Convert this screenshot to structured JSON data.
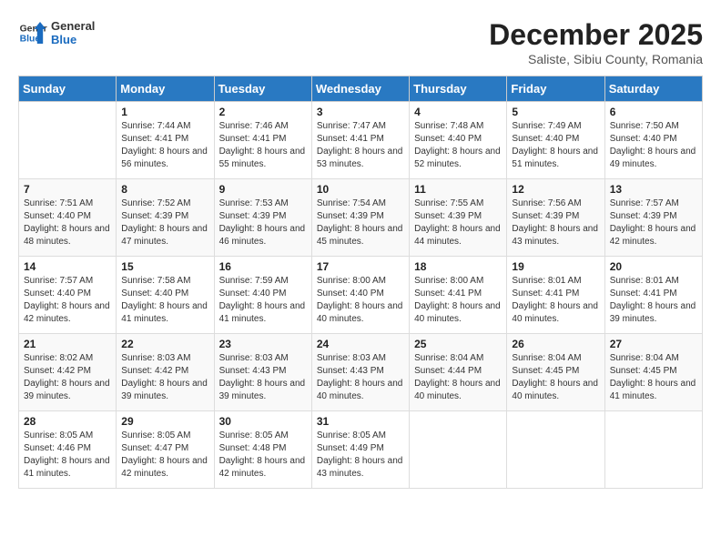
{
  "header": {
    "logo_general": "General",
    "logo_blue": "Blue",
    "month_title": "December 2025",
    "subtitle": "Saliste, Sibiu County, Romania"
  },
  "days_of_week": [
    "Sunday",
    "Monday",
    "Tuesday",
    "Wednesday",
    "Thursday",
    "Friday",
    "Saturday"
  ],
  "weeks": [
    [
      {
        "day": "",
        "sunrise": "",
        "sunset": "",
        "daylight": ""
      },
      {
        "day": "1",
        "sunrise": "7:44 AM",
        "sunset": "4:41 PM",
        "daylight": "8 hours and 56 minutes."
      },
      {
        "day": "2",
        "sunrise": "7:46 AM",
        "sunset": "4:41 PM",
        "daylight": "8 hours and 55 minutes."
      },
      {
        "day": "3",
        "sunrise": "7:47 AM",
        "sunset": "4:41 PM",
        "daylight": "8 hours and 53 minutes."
      },
      {
        "day": "4",
        "sunrise": "7:48 AM",
        "sunset": "4:40 PM",
        "daylight": "8 hours and 52 minutes."
      },
      {
        "day": "5",
        "sunrise": "7:49 AM",
        "sunset": "4:40 PM",
        "daylight": "8 hours and 51 minutes."
      },
      {
        "day": "6",
        "sunrise": "7:50 AM",
        "sunset": "4:40 PM",
        "daylight": "8 hours and 49 minutes."
      }
    ],
    [
      {
        "day": "7",
        "sunrise": "7:51 AM",
        "sunset": "4:40 PM",
        "daylight": "8 hours and 48 minutes."
      },
      {
        "day": "8",
        "sunrise": "7:52 AM",
        "sunset": "4:39 PM",
        "daylight": "8 hours and 47 minutes."
      },
      {
        "day": "9",
        "sunrise": "7:53 AM",
        "sunset": "4:39 PM",
        "daylight": "8 hours and 46 minutes."
      },
      {
        "day": "10",
        "sunrise": "7:54 AM",
        "sunset": "4:39 PM",
        "daylight": "8 hours and 45 minutes."
      },
      {
        "day": "11",
        "sunrise": "7:55 AM",
        "sunset": "4:39 PM",
        "daylight": "8 hours and 44 minutes."
      },
      {
        "day": "12",
        "sunrise": "7:56 AM",
        "sunset": "4:39 PM",
        "daylight": "8 hours and 43 minutes."
      },
      {
        "day": "13",
        "sunrise": "7:57 AM",
        "sunset": "4:39 PM",
        "daylight": "8 hours and 42 minutes."
      }
    ],
    [
      {
        "day": "14",
        "sunrise": "7:57 AM",
        "sunset": "4:40 PM",
        "daylight": "8 hours and 42 minutes."
      },
      {
        "day": "15",
        "sunrise": "7:58 AM",
        "sunset": "4:40 PM",
        "daylight": "8 hours and 41 minutes."
      },
      {
        "day": "16",
        "sunrise": "7:59 AM",
        "sunset": "4:40 PM",
        "daylight": "8 hours and 41 minutes."
      },
      {
        "day": "17",
        "sunrise": "8:00 AM",
        "sunset": "4:40 PM",
        "daylight": "8 hours and 40 minutes."
      },
      {
        "day": "18",
        "sunrise": "8:00 AM",
        "sunset": "4:41 PM",
        "daylight": "8 hours and 40 minutes."
      },
      {
        "day": "19",
        "sunrise": "8:01 AM",
        "sunset": "4:41 PM",
        "daylight": "8 hours and 40 minutes."
      },
      {
        "day": "20",
        "sunrise": "8:01 AM",
        "sunset": "4:41 PM",
        "daylight": "8 hours and 39 minutes."
      }
    ],
    [
      {
        "day": "21",
        "sunrise": "8:02 AM",
        "sunset": "4:42 PM",
        "daylight": "8 hours and 39 minutes."
      },
      {
        "day": "22",
        "sunrise": "8:03 AM",
        "sunset": "4:42 PM",
        "daylight": "8 hours and 39 minutes."
      },
      {
        "day": "23",
        "sunrise": "8:03 AM",
        "sunset": "4:43 PM",
        "daylight": "8 hours and 39 minutes."
      },
      {
        "day": "24",
        "sunrise": "8:03 AM",
        "sunset": "4:43 PM",
        "daylight": "8 hours and 40 minutes."
      },
      {
        "day": "25",
        "sunrise": "8:04 AM",
        "sunset": "4:44 PM",
        "daylight": "8 hours and 40 minutes."
      },
      {
        "day": "26",
        "sunrise": "8:04 AM",
        "sunset": "4:45 PM",
        "daylight": "8 hours and 40 minutes."
      },
      {
        "day": "27",
        "sunrise": "8:04 AM",
        "sunset": "4:45 PM",
        "daylight": "8 hours and 41 minutes."
      }
    ],
    [
      {
        "day": "28",
        "sunrise": "8:05 AM",
        "sunset": "4:46 PM",
        "daylight": "8 hours and 41 minutes."
      },
      {
        "day": "29",
        "sunrise": "8:05 AM",
        "sunset": "4:47 PM",
        "daylight": "8 hours and 42 minutes."
      },
      {
        "day": "30",
        "sunrise": "8:05 AM",
        "sunset": "4:48 PM",
        "daylight": "8 hours and 42 minutes."
      },
      {
        "day": "31",
        "sunrise": "8:05 AM",
        "sunset": "4:49 PM",
        "daylight": "8 hours and 43 minutes."
      },
      {
        "day": "",
        "sunrise": "",
        "sunset": "",
        "daylight": ""
      },
      {
        "day": "",
        "sunrise": "",
        "sunset": "",
        "daylight": ""
      },
      {
        "day": "",
        "sunrise": "",
        "sunset": "",
        "daylight": ""
      }
    ]
  ],
  "labels": {
    "sunrise": "Sunrise:",
    "sunset": "Sunset:",
    "daylight": "Daylight:"
  }
}
